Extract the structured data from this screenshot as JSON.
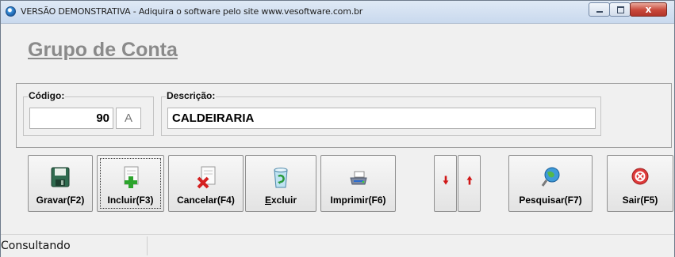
{
  "window": {
    "title": "VERSÃO DEMONSTRATIVA - Adiquira o software pelo site www.vesoftware.com.br",
    "controls": {
      "close_glyph": "x"
    }
  },
  "form": {
    "heading": "Grupo de Conta",
    "codigo": {
      "label": "Código:",
      "value": "90",
      "suffix": "A"
    },
    "descricao": {
      "label": "Descrição:",
      "value": "CALDEIRARIA"
    }
  },
  "toolbar": {
    "gravar": {
      "label": "Gravar(F2)",
      "icon": "floppy-disk-icon"
    },
    "incluir": {
      "label": "Incluir(F3)",
      "icon": "add-document-icon"
    },
    "cancelar": {
      "label": "Cancelar(F4)",
      "icon": "cancel-document-icon"
    },
    "excluir": {
      "label_first": "E",
      "label_rest": "xcluir",
      "icon": "recycle-bin-icon"
    },
    "imprimir": {
      "label": "Imprimir(F6)",
      "icon": "printer-icon"
    },
    "down": {
      "icon": "arrow-down-icon"
    },
    "up": {
      "icon": "arrow-up-icon"
    },
    "pesquisar": {
      "label": "Pesquisar(F7)",
      "icon": "globe-search-icon"
    },
    "sair": {
      "label": "Sair(F5)",
      "icon": "exit-icon"
    }
  },
  "status": {
    "text": "Consultando"
  },
  "colors": {
    "heading": "#8a8a8a",
    "close_button": "#c8473a",
    "arrow": "#d01818"
  }
}
